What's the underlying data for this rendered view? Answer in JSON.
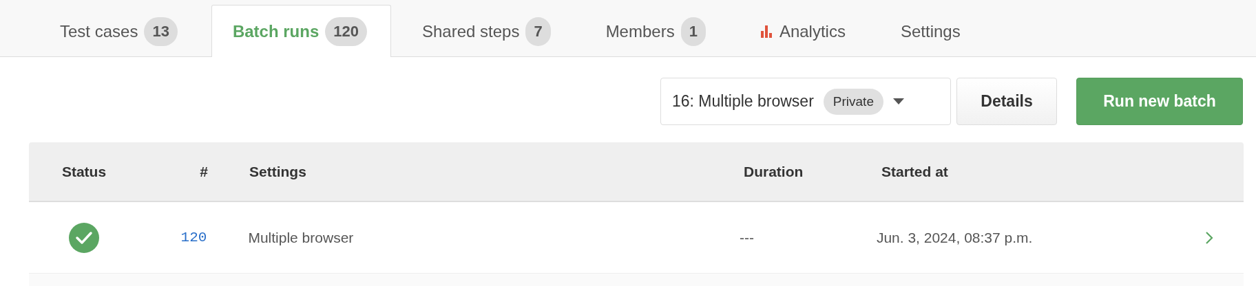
{
  "tabs": [
    {
      "label": "Test cases",
      "count": "13",
      "kind": "plain",
      "selected": false
    },
    {
      "label": "Batch runs",
      "count": "120",
      "kind": "plain",
      "selected": true
    },
    {
      "label": "Shared steps",
      "count": "7",
      "kind": "plain",
      "selected": false
    },
    {
      "label": "Members",
      "count": "1",
      "kind": "plain",
      "selected": false
    },
    {
      "label": "Analytics",
      "kind": "chart",
      "selected": false
    },
    {
      "label": "Settings",
      "kind": "plain",
      "selected": false
    }
  ],
  "toolbar": {
    "dropdown": {
      "value": "16: Multiple browser",
      "badge": "Private"
    },
    "buttons": [
      {
        "label": "Details",
        "kind": "secondary"
      },
      {
        "label": "Run new batch",
        "kind": "primary"
      }
    ]
  },
  "table": {
    "columns": [
      "Status",
      "#",
      "Settings",
      "Duration",
      "Started at"
    ],
    "rows": [
      {
        "passed": true,
        "number": "120",
        "settings": "Multiple browser",
        "duration": "---",
        "started_at": "Jun. 3, 2024, 08:37 p.m."
      }
    ]
  }
}
